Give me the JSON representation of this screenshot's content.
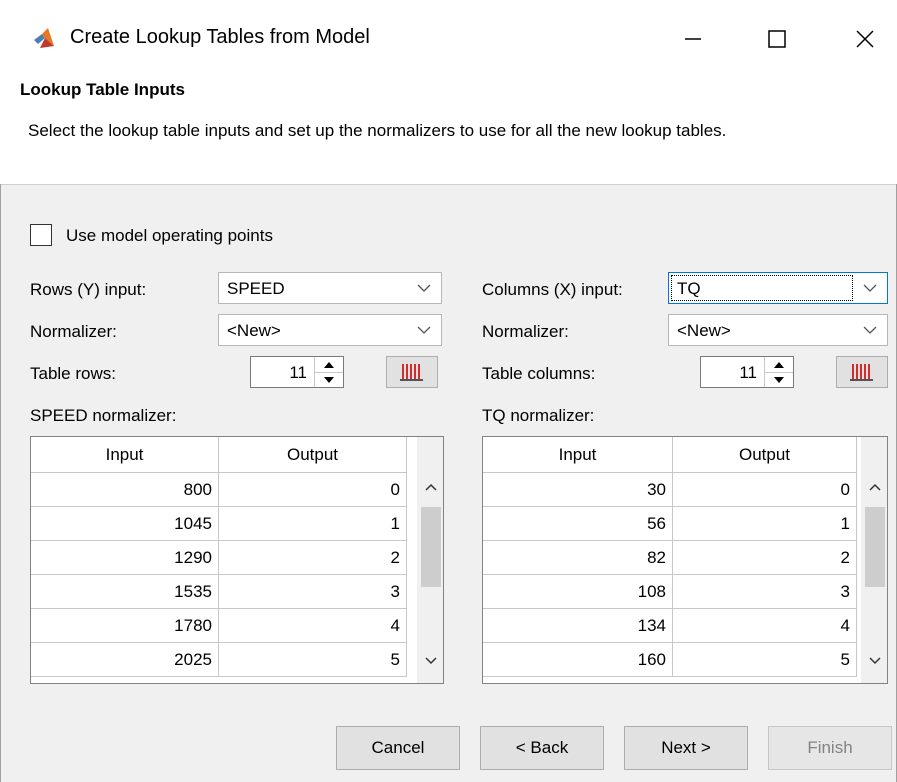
{
  "window": {
    "title": "Create Lookup Tables from Model",
    "icon": "matlab-icon",
    "controls": [
      "minimize-icon",
      "maximize-icon",
      "close-icon"
    ]
  },
  "header": {
    "title": "Lookup Table Inputs",
    "description": "Select the lookup table inputs and set up the normalizers to use for all the new lookup tables."
  },
  "options": {
    "use_operating_points_label": "Use model operating points",
    "use_operating_points_checked": false
  },
  "rows_panel": {
    "input_label": "Rows (Y) input:",
    "input_value": "SPEED",
    "normalizer_label": "Normalizer:",
    "normalizer_value": "<New>",
    "count_label": "Table rows:",
    "count_value": "11",
    "table_label": "SPEED normalizer:",
    "columns": [
      "Input",
      "Output"
    ],
    "rows": [
      [
        "800",
        "0"
      ],
      [
        "1045",
        "1"
      ],
      [
        "1290",
        "2"
      ],
      [
        "1535",
        "3"
      ],
      [
        "1780",
        "4"
      ],
      [
        "2025",
        "5"
      ]
    ]
  },
  "cols_panel": {
    "input_label": "Columns (X) input:",
    "input_value": "TQ",
    "normalizer_label": "Normalizer:",
    "normalizer_value": "<New>",
    "count_label": "Table columns:",
    "count_value": "11",
    "table_label": "TQ normalizer:",
    "columns": [
      "Input",
      "Output"
    ],
    "rows": [
      [
        "30",
        "0"
      ],
      [
        "56",
        "1"
      ],
      [
        "82",
        "2"
      ],
      [
        "108",
        "3"
      ],
      [
        "134",
        "4"
      ],
      [
        "160",
        "5"
      ]
    ]
  },
  "footer": {
    "cancel": "Cancel",
    "back": "< Back",
    "next": "Next >",
    "finish": "Finish",
    "finish_enabled": false
  },
  "colors": {
    "plot_icon": "#cc0000",
    "focus": "#0078d7"
  }
}
